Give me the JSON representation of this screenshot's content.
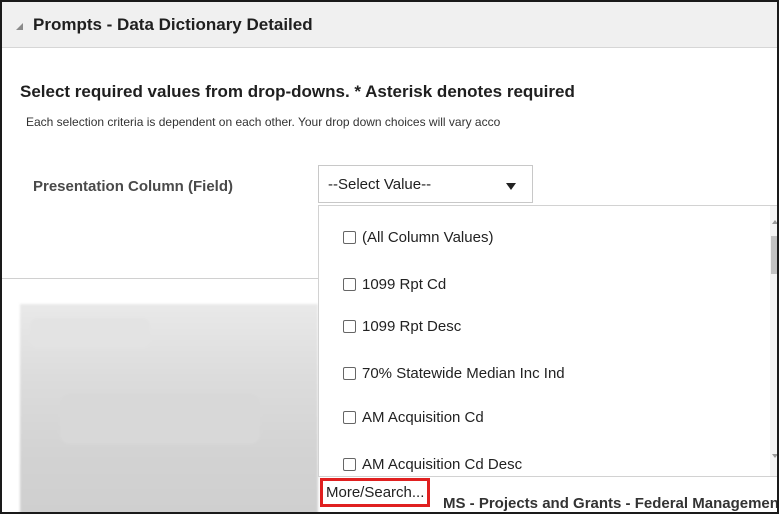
{
  "panel": {
    "title": "Prompts - Data Dictionary Detailed"
  },
  "instructions": {
    "heading": "Select required values from drop-downs. * Asterisk denotes required",
    "note": "Each selection criteria is dependent on each other.  Your drop down choices will vary acco"
  },
  "prompt": {
    "label": "Presentation Column (Field)",
    "selected_value": "--Select Value--"
  },
  "dropdown": {
    "options": [
      {
        "label": "(All Column Values)",
        "checked": false
      },
      {
        "label": "1099 Rpt Cd",
        "checked": false
      },
      {
        "label": "1099 Rpt Desc",
        "checked": false
      },
      {
        "label": "70% Statewide Median Inc Ind",
        "checked": false
      },
      {
        "label": "AM Acquisition Cd",
        "checked": false
      },
      {
        "label": "AM Acquisition Cd Desc",
        "checked": false
      }
    ],
    "more_search_label": "More/Search..."
  },
  "background_item": {
    "text": "MS - Projects and Grants - Federal Management Su"
  },
  "colors": {
    "highlight_border": "#e02020",
    "header_bg": "#f0f0f0"
  }
}
